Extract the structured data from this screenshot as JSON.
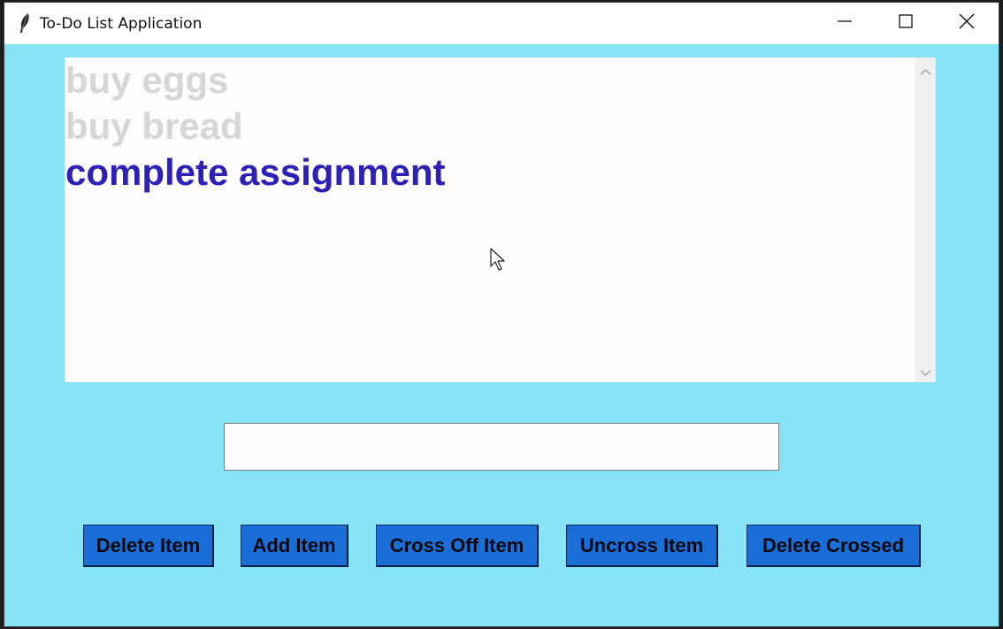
{
  "window": {
    "title": "To-Do List Application",
    "background": "#87e4f6"
  },
  "listbox": {
    "items": [
      {
        "label": "buy eggs",
        "state": "crossed",
        "color": "#d7d5d7"
      },
      {
        "label": "buy bread",
        "state": "crossed",
        "color": "#d7d5d7"
      },
      {
        "label": "complete assignment",
        "state": "active",
        "color": "#2d20b7"
      }
    ]
  },
  "entry": {
    "value": ""
  },
  "buttons": {
    "delete_item": "Delete Item",
    "add_item": "Add Item",
    "cross_off_item": "Cross Off Item",
    "uncross_item": "Uncross Item",
    "delete_crossed": "Delete Crossed",
    "color": "#1a6ed8"
  },
  "icons": {
    "app": "feather-icon",
    "minimize": "minimize-icon",
    "maximize": "maximize-icon",
    "close": "close-icon",
    "cursor": "mouse-cursor-icon"
  }
}
